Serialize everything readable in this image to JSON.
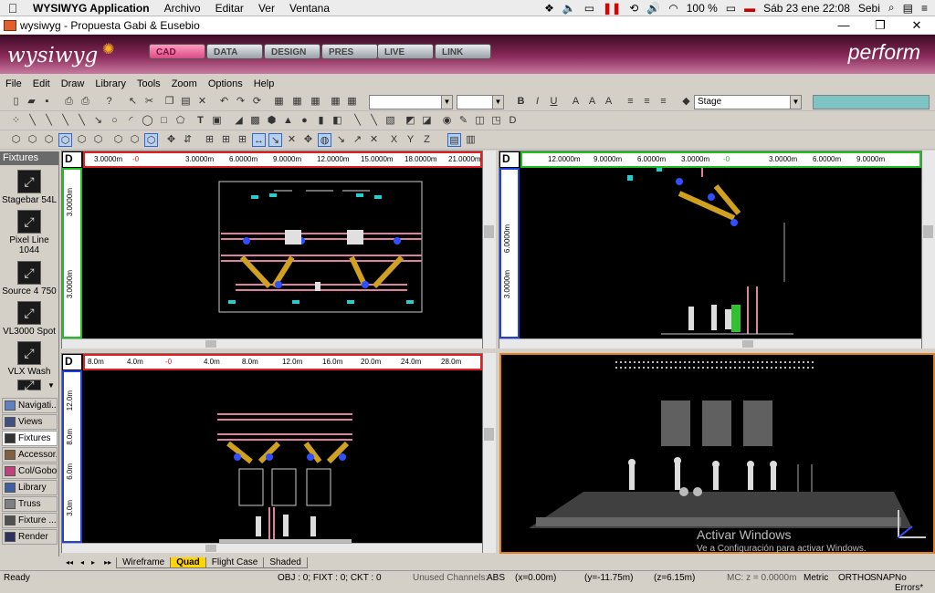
{
  "mac_menu": {
    "app_name": "WYSIWYG Application",
    "items": [
      "Archivo",
      "Editar",
      "Ver",
      "Ventana"
    ],
    "battery": "100 %",
    "datetime": "Sáb 23 ene  22:08",
    "user": "Sebi"
  },
  "window": {
    "title": "wysiwyg - Propuesta Gabi & Eusebio"
  },
  "banner": {
    "logo": "wysiwyg",
    "product": "perform",
    "mode_tabs": [
      "CAD",
      "DATA",
      "DESIGN",
      "PRES",
      "LIVE",
      "LINK"
    ],
    "active_tab": "CAD"
  },
  "menu": [
    "File",
    "Edit",
    "Draw",
    "Library",
    "Tools",
    "Zoom",
    "Options",
    "Help"
  ],
  "toolbar": {
    "layer_value": "Stage"
  },
  "fixtures_panel": {
    "header": "Fixtures",
    "items": [
      "Stagebar 54L",
      "Pixel Line 1044",
      "Source 4 750",
      "VL3000 Spot",
      "VLX Wash"
    ]
  },
  "nav_panel": {
    "items": [
      "Navigati...",
      "Views",
      "Fixtures",
      "Accessor...",
      "Col/Gobo",
      "Library",
      "Truss",
      "Fixture ...",
      "Render"
    ],
    "selected": "Fixtures"
  },
  "viewports": {
    "top_left": {
      "corner": "D",
      "ruler_h": [
        "3.0000m",
        "-0",
        "3.0000m",
        "6.0000m",
        "9.0000m",
        "12.0000m",
        "15.0000m",
        "18.0000m",
        "21.0000m"
      ],
      "ruler_v": [
        "3.0000m",
        "3.0000m"
      ]
    },
    "top_right": {
      "corner": "D",
      "ruler_h": [
        "12.0000m",
        "9.0000m",
        "6.0000m",
        "3.0000m",
        "-0",
        "3.0000m",
        "6.0000m",
        "9.0000m"
      ],
      "ruler_v": [
        "6.0000m",
        "3.0000m"
      ]
    },
    "bottom_left": {
      "corner": "D",
      "ruler_h": [
        "8.0m",
        "4.0m",
        "-0",
        "4.0m",
        "8.0m",
        "12.0m",
        "16.0m",
        "20.0m",
        "24.0m",
        "28.0m"
      ],
      "ruler_v": [
        "12.0m",
        "8.0m",
        "6.0m",
        "3.0m"
      ]
    }
  },
  "view_tabs": [
    "Wireframe",
    "Quad",
    "Flight Case",
    "Shaded"
  ],
  "selected_view_tab": "Quad",
  "status": {
    "ready": "Ready",
    "counts": "OBJ : 0; FIXT : 0; CKT : 0",
    "unused": "Unused Channels:",
    "abs": "ABS",
    "x": "(x=0.00m)",
    "y": "(y=-11.75m)",
    "z": "(z=6.15m)",
    "mc": "MC: z = 0.0000m",
    "units": "Metric",
    "ortho": "ORTHO",
    "snap": "SNAP",
    "errors": "No Errors*"
  },
  "activation": {
    "title": "Activar Windows",
    "subtitle": "Ve a Configuración para activar Windows."
  },
  "colors": {
    "banner_dark": "#3a0a24",
    "active_tab": "#e05a90",
    "ruler_red": "#e02020",
    "ruler_green": "#20c020",
    "ruler_blue": "#2040e0"
  }
}
